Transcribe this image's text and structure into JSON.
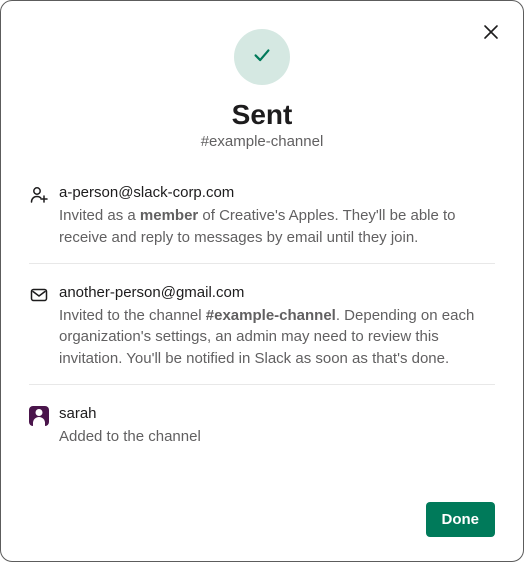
{
  "header": {
    "title": "Sent",
    "subtitle": "#example-channel"
  },
  "invites": [
    {
      "email": "a-person@slack-corp.com",
      "desc_prefix": "Invited as a ",
      "desc_bold": "member",
      "desc_suffix": " of Creative's Apples. They'll be able to receive and reply to messages by email until they join."
    },
    {
      "email": "another-person@gmail.com",
      "desc_prefix": "Invited to the channel ",
      "desc_bold": "#example-channel",
      "desc_suffix": ". Depending on each organization's settings, an admin may need to review this invitation. You'll be notified in Slack as soon as that's done."
    },
    {
      "email": "sarah",
      "desc_plain": "Added to the channel"
    }
  ],
  "footer": {
    "done_label": "Done"
  }
}
